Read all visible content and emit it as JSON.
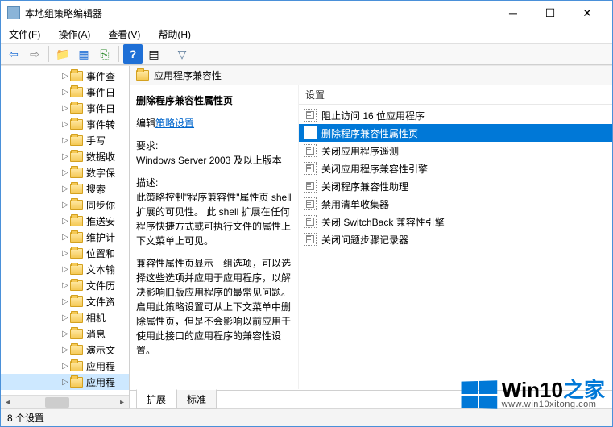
{
  "window": {
    "title": "本地组策略编辑器"
  },
  "menu": {
    "file": "文件(F)",
    "action": "操作(A)",
    "view": "查看(V)",
    "help": "帮助(H)"
  },
  "tree": {
    "items": [
      {
        "label": "事件查"
      },
      {
        "label": "事件日"
      },
      {
        "label": "事件日"
      },
      {
        "label": "事件转"
      },
      {
        "label": "手写"
      },
      {
        "label": "数据收"
      },
      {
        "label": "数字保"
      },
      {
        "label": "搜索"
      },
      {
        "label": "同步你"
      },
      {
        "label": "推送安"
      },
      {
        "label": "维护计"
      },
      {
        "label": "位置和"
      },
      {
        "label": "文本输"
      },
      {
        "label": "文件历"
      },
      {
        "label": "文件资"
      },
      {
        "label": "相机"
      },
      {
        "label": "消息"
      },
      {
        "label": "演示文"
      },
      {
        "label": "应用程"
      },
      {
        "label": "应用程"
      }
    ],
    "selected_index": 19
  },
  "header": {
    "title": "应用程序兼容性"
  },
  "detail": {
    "title": "删除程序兼容性属性页",
    "edit_prefix": "编辑",
    "edit_link": "策略设置",
    "req_label": "要求:",
    "req_text": "Windows Server 2003 及以上版本",
    "desc_label": "描述:",
    "desc_p1": "此策略控制\"程序兼容性\"属性页 shell 扩展的可见性。  此 shell 扩展在任何程序快捷方式或可执行文件的属性上下文菜单上可见。",
    "desc_p2": "兼容性属性页显示一组选项，可以选择这些选项并应用于应用程序，以解决影响旧版应用程序的最常见问题。启用此策略设置可从上下文菜单中删除属性页，但是不会影响以前应用于使用此接口的应用程序的兼容性设置。"
  },
  "settings": {
    "header": "设置",
    "rows": [
      "阻止访问 16 位应用程序",
      "删除程序兼容性属性页",
      "关闭应用程序遥测",
      "关闭应用程序兼容性引擎",
      "关闭程序兼容性助理",
      "禁用清单收集器",
      "关闭 SwitchBack 兼容性引擎",
      "关闭问题步骤记录器"
    ],
    "selected_index": 1
  },
  "tabs": {
    "extended": "扩展",
    "standard": "标准"
  },
  "status": {
    "text": "8 个设置"
  },
  "watermark": {
    "brand_a": "Win10",
    "brand_b": "之家",
    "url": "www.win10xitong.com"
  }
}
